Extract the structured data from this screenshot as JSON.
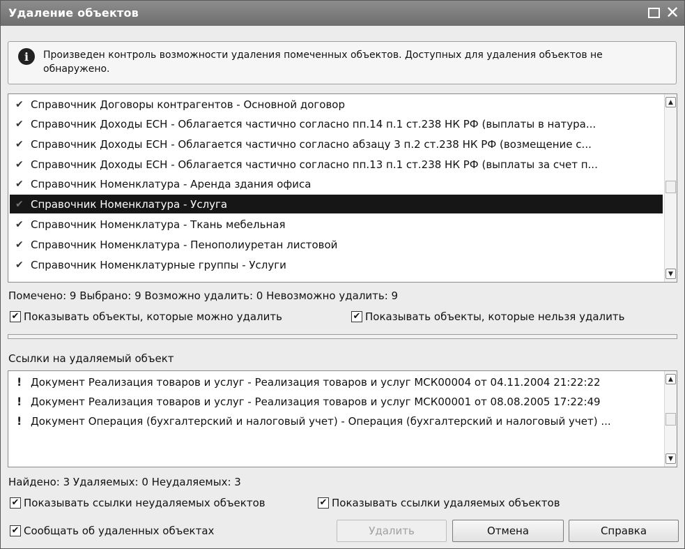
{
  "window": {
    "title": "Удаление объектов",
    "maximize_icon": "maximize-icon",
    "close_icon": "close-icon",
    "close_glyph": "✕"
  },
  "info": {
    "icon": "info-icon",
    "icon_glyph": "i",
    "text": "Произведен контроль возможности удаления помеченных объектов. Доступных для удаления объектов не обнаружено."
  },
  "objects_list": {
    "items": [
      {
        "text": "Справочник Договоры контрагентов - Основной договор",
        "checked": true,
        "selected": false
      },
      {
        "text": "Справочник Доходы ЕСН - Облагается частично согласно пп.14 п.1 ст.238 НК РФ (выплаты в натура...",
        "checked": true,
        "selected": false
      },
      {
        "text": "Справочник Доходы ЕСН - Облагается частично согласно абзацу 3 п.2 ст.238 НК РФ (возмещение с...",
        "checked": true,
        "selected": false
      },
      {
        "text": "Справочник Доходы ЕСН - Облагается частично согласно пп.13 п.1 ст.238 НК РФ (выплаты за счет п...",
        "checked": true,
        "selected": false
      },
      {
        "text": "Справочник Номенклатура - Аренда здания офиса",
        "checked": true,
        "selected": false
      },
      {
        "text": "Справочник Номенклатура - Услуга",
        "checked": true,
        "selected": true
      },
      {
        "text": "Справочник Номенклатура - Ткань мебельная",
        "checked": true,
        "selected": false
      },
      {
        "text": "Справочник Номенклатура - Пенополиуретан листовой",
        "checked": true,
        "selected": false
      },
      {
        "text": "Справочник Номенклатурные группы - Услуги",
        "checked": true,
        "selected": false
      }
    ],
    "check_glyph": "✔"
  },
  "objects_status": "Помечено: 9  Выбрано: 9  Возможно удалить: 0  Невозможно удалить: 9",
  "objects_filters": {
    "show_deletable": {
      "label": "Показывать объекты, которые можно удалить",
      "checked": true
    },
    "show_undeletable": {
      "label": "Показывать объекты, которые нельзя удалить",
      "checked": true
    }
  },
  "refs_section_label": "Ссылки на удаляемый объект",
  "refs_list": {
    "items": [
      {
        "text": "Документ Реализация товаров и услуг - Реализация товаров и услуг МСК00004 от 04.11.2004 21:22:22"
      },
      {
        "text": "Документ Реализация товаров и услуг - Реализация товаров и услуг МСК00001 от 08.08.2005 17:22:49"
      },
      {
        "text": "Документ Операция (бухгалтерский и налоговый учет) - Операция (бухгалтерский и налоговый учет) ..."
      }
    ],
    "marker_icon": "exclamation-icon",
    "marker_glyph": "!"
  },
  "refs_status": "Найдено: 3  Удаляемых: 0  Неудаляемых: 3",
  "refs_filters": {
    "show_undeletable_refs": {
      "label": "Показывать ссылки неудаляемых объектов",
      "checked": true
    },
    "show_deletable_refs": {
      "label": "Показывать ссылки удаляемых объектов",
      "checked": true
    }
  },
  "report_deleted": {
    "label": "Сообщать об удаленных объектах",
    "checked": true
  },
  "buttons": {
    "delete": "Удалить",
    "cancel": "Отмена",
    "help": "Справка"
  },
  "checkbox_glyph": "✔",
  "scroll_up_glyph": "▲",
  "scroll_down_glyph": "▼"
}
